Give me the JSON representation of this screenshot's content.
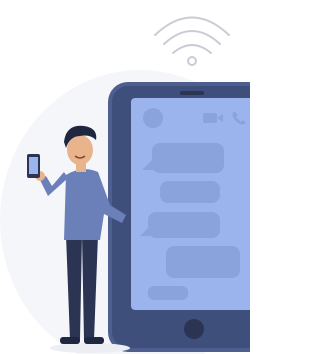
{
  "illustration": {
    "subject": "person-with-phone-beside-large-smartphone",
    "colors": {
      "background": "#ffffff",
      "wifi_outline": "#c9ccd3",
      "phone_frame": "#4e5f8f",
      "phone_frame_dark": "#3f4f7c",
      "phone_screen": "#9bb4ee",
      "chat_bubble": "#8aa3dd",
      "shirt": "#6b7fb8",
      "pants": "#2b3452",
      "hair": "#1f2740",
      "skin": "#e9b48c",
      "shadow": "#eceef3"
    },
    "icons": [
      "wifi-icon",
      "video-call-icon",
      "phone-call-icon",
      "small-phone-icon"
    ]
  }
}
